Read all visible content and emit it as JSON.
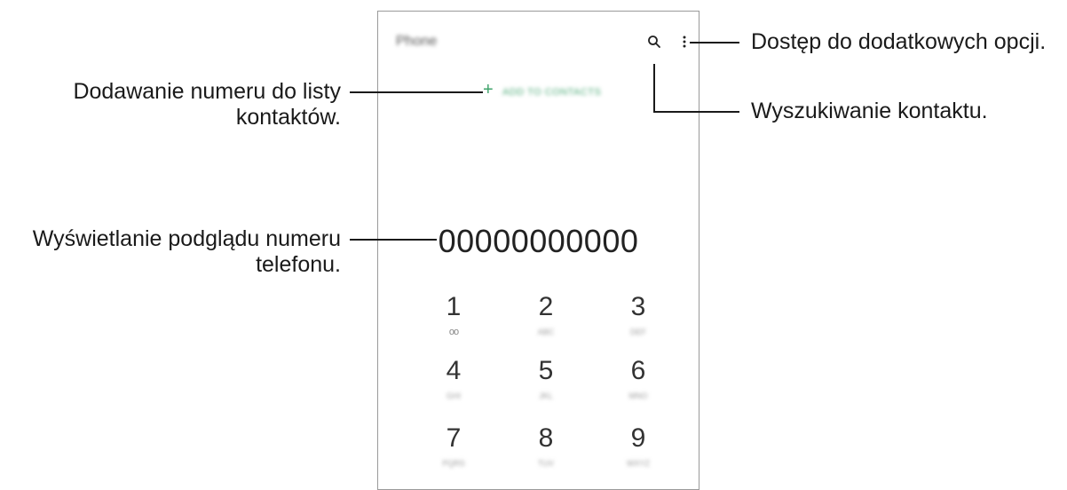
{
  "phone": {
    "title": "Phone",
    "add_contact_label": "ADD TO CONTACTS",
    "number": "00000000000",
    "keys": [
      {
        "digit": "1",
        "sub": "oo"
      },
      {
        "digit": "2",
        "sub": "ABC"
      },
      {
        "digit": "3",
        "sub": "DEF"
      },
      {
        "digit": "4",
        "sub": "GHI"
      },
      {
        "digit": "5",
        "sub": "JKL"
      },
      {
        "digit": "6",
        "sub": "MNO"
      },
      {
        "digit": "7",
        "sub": "PQRS"
      },
      {
        "digit": "8",
        "sub": "TUV"
      },
      {
        "digit": "9",
        "sub": "WXYZ"
      }
    ]
  },
  "callouts": {
    "more_options": "Dostęp do dodatkowych opcji.",
    "search_contact": "Wyszukiwanie kontaktu.",
    "add_contact_line1": "Dodawanie numeru do listy",
    "add_contact_line2": "kontaktów.",
    "preview_line1": "Wyświetlanie podglądu numeru",
    "preview_line2": "telefonu."
  },
  "icons": [
    "search-icon",
    "more-options-icon",
    "plus-icon",
    "voicemail-icon"
  ],
  "colors": {
    "accent": "#3fa36a",
    "border": "#9a9a9a"
  }
}
